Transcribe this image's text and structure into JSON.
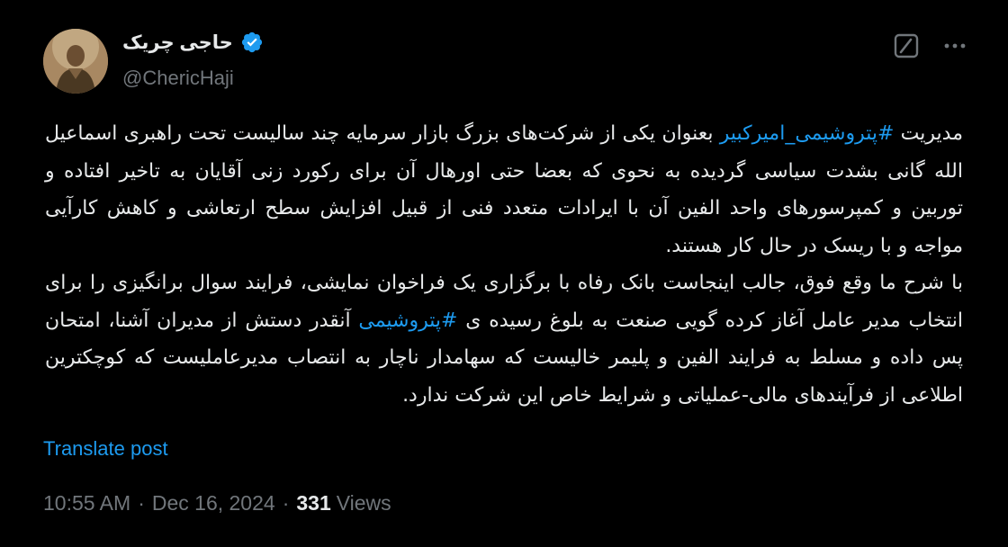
{
  "author": {
    "name": "حاجی چریک",
    "handle": "@ChericHaji",
    "verified": true,
    "verified_color": "#1d9bf0",
    "avatar_icon": "profile-photo"
  },
  "actions": {
    "grok_icon": "grok-icon",
    "more_icon": "more-icon"
  },
  "body": {
    "p1_a": "مدیریت ",
    "p1_tag": "#پتروشیمی_امیرکبیر",
    "p1_b": " بعنوان یکی از شرکت‌های بزرگ بازار سرمایه چند سالیست تحت راهبری اسماعیل الله گانی بشدت سیاسی گردیده به نحوی که بعضا حتی اورهال آن برای رکورد زنی آقایان به تاخیر افتاده و توربین و کمپرسورهای واحد الفین آن با ایرادات متعدد فنی از قبیل افزایش سطح ارتعاشی و کاهش کارآیی مواجه و با ریسک در حال کار هستند.",
    "p2_a": "با شرح ما وقع فوق، جالب اینجاست بانک رفاه با برگزاری یک فراخوان نمایشی، فرایند سوال برانگیزی را برای انتخاب مدیر عامل آغاز کرده گویی صنعت به بلوغ رسیده ی ",
    "p2_tag": "#پتروشیمی",
    "p2_b": " آنقدر دستش از مدیران آشنا، امتحان پس داده و مسلط به فرایند الفین و پلیمر خالیست که سهامدار ناچار به انتصاب مدیرعاملیست که کوچکترین اطلاعی از فرآیندهای مالی-عملیاتی و شرایط خاص این شرکت ندارد."
  },
  "translate_label": "Translate post",
  "meta": {
    "time": "10:55 AM",
    "separator": "·",
    "date": "Dec 16, 2024",
    "views_count": "331",
    "views_label": "Views"
  },
  "colors": {
    "background": "#000000",
    "text": "#e7e9ea",
    "secondary": "#71767b",
    "accent": "#1d9bf0"
  }
}
